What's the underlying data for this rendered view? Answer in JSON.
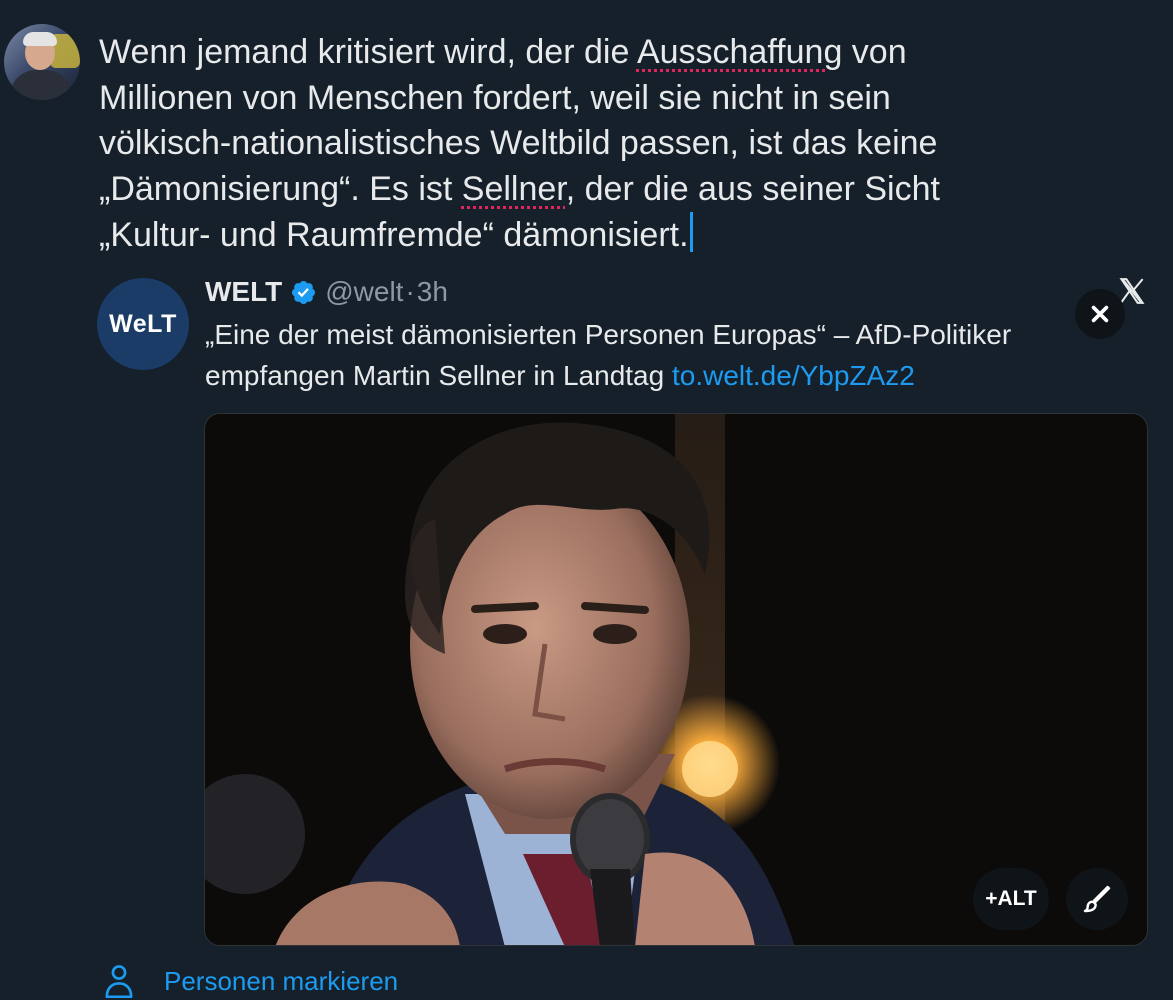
{
  "compose": {
    "line1_a": "Wenn jemand kritisiert wird, der die ",
    "word_ausschaffung": "Ausschaffung",
    "line1_b": " von",
    "line2": "Millionen von Menschen fordert, weil sie nicht in sein",
    "line3": "völkisch-nationalistisches Weltbild passen, ist das keine",
    "line4_a": "„Dämonisierung“. Es ist ",
    "word_sellner": "Sellner",
    "line4_b": ", der die aus seiner Sicht",
    "line5": "„Kultur- und Raumfremde“ dämonisiert."
  },
  "quoted_tweet": {
    "logo_text": "WeLT",
    "author_name": "WELT",
    "handle": "@welt",
    "separator": "·",
    "time": "3h",
    "text": "„Eine der meist dämonisierten Personen Europas“ – AfD-Politiker empfangen Martin Sellner in Landtag ",
    "link": "to.welt.de/YbpZAz2"
  },
  "media": {
    "alt_label": "+ALT"
  },
  "tag_people": {
    "label": "Personen markieren"
  },
  "colors": {
    "background": "#15202b",
    "accent": "#1d9bf0",
    "text": "#e7e9ea",
    "muted": "#8b98a5",
    "spellcheck": "#e0245e"
  },
  "icons": [
    "x-logo-icon",
    "close-icon",
    "verified-badge-icon",
    "edit-brush-icon",
    "person-icon"
  ]
}
